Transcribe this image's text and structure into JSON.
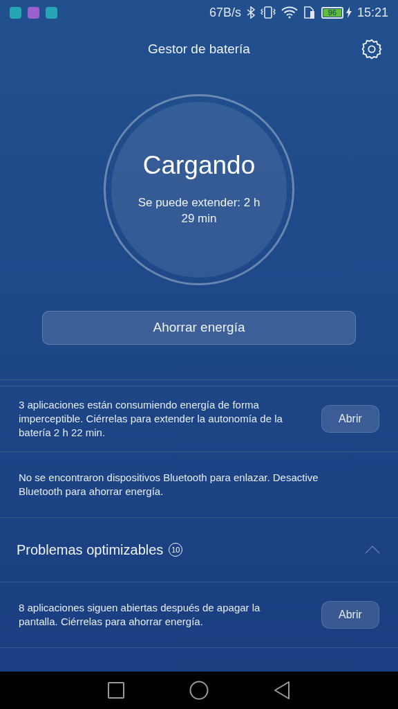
{
  "status_bar": {
    "speed": "67B/s",
    "battery": "96",
    "time": "15:21",
    "notification_icons": [
      {
        "color": "#26a6b5"
      },
      {
        "color": "#9b5fd0"
      },
      {
        "color": "#26a6b5"
      }
    ]
  },
  "header": {
    "title": "Gestor de batería"
  },
  "gauge": {
    "state": "Cargando",
    "detail": "Se puede extender: 2 h 29 min"
  },
  "save_button": "Ahorrar energía",
  "items": [
    {
      "text": "3 aplicaciones están consumiendo energía de forma imperceptible. Ciérrelas para extender la autonomía de la batería 2 h 22 min.",
      "action": "Abrir"
    },
    {
      "text": "No se encontraron dispositivos Bluetooth para enlazar. Desactive Bluetooth para ahorrar energía."
    }
  ],
  "section": {
    "title": "Problemas optimizables",
    "count": "10",
    "expanded": true,
    "items": [
      {
        "text": "8 aplicaciones siguen abiertas después de apagar la pantalla. Ciérrelas para ahorrar energía.",
        "action": "Abrir"
      }
    ]
  }
}
